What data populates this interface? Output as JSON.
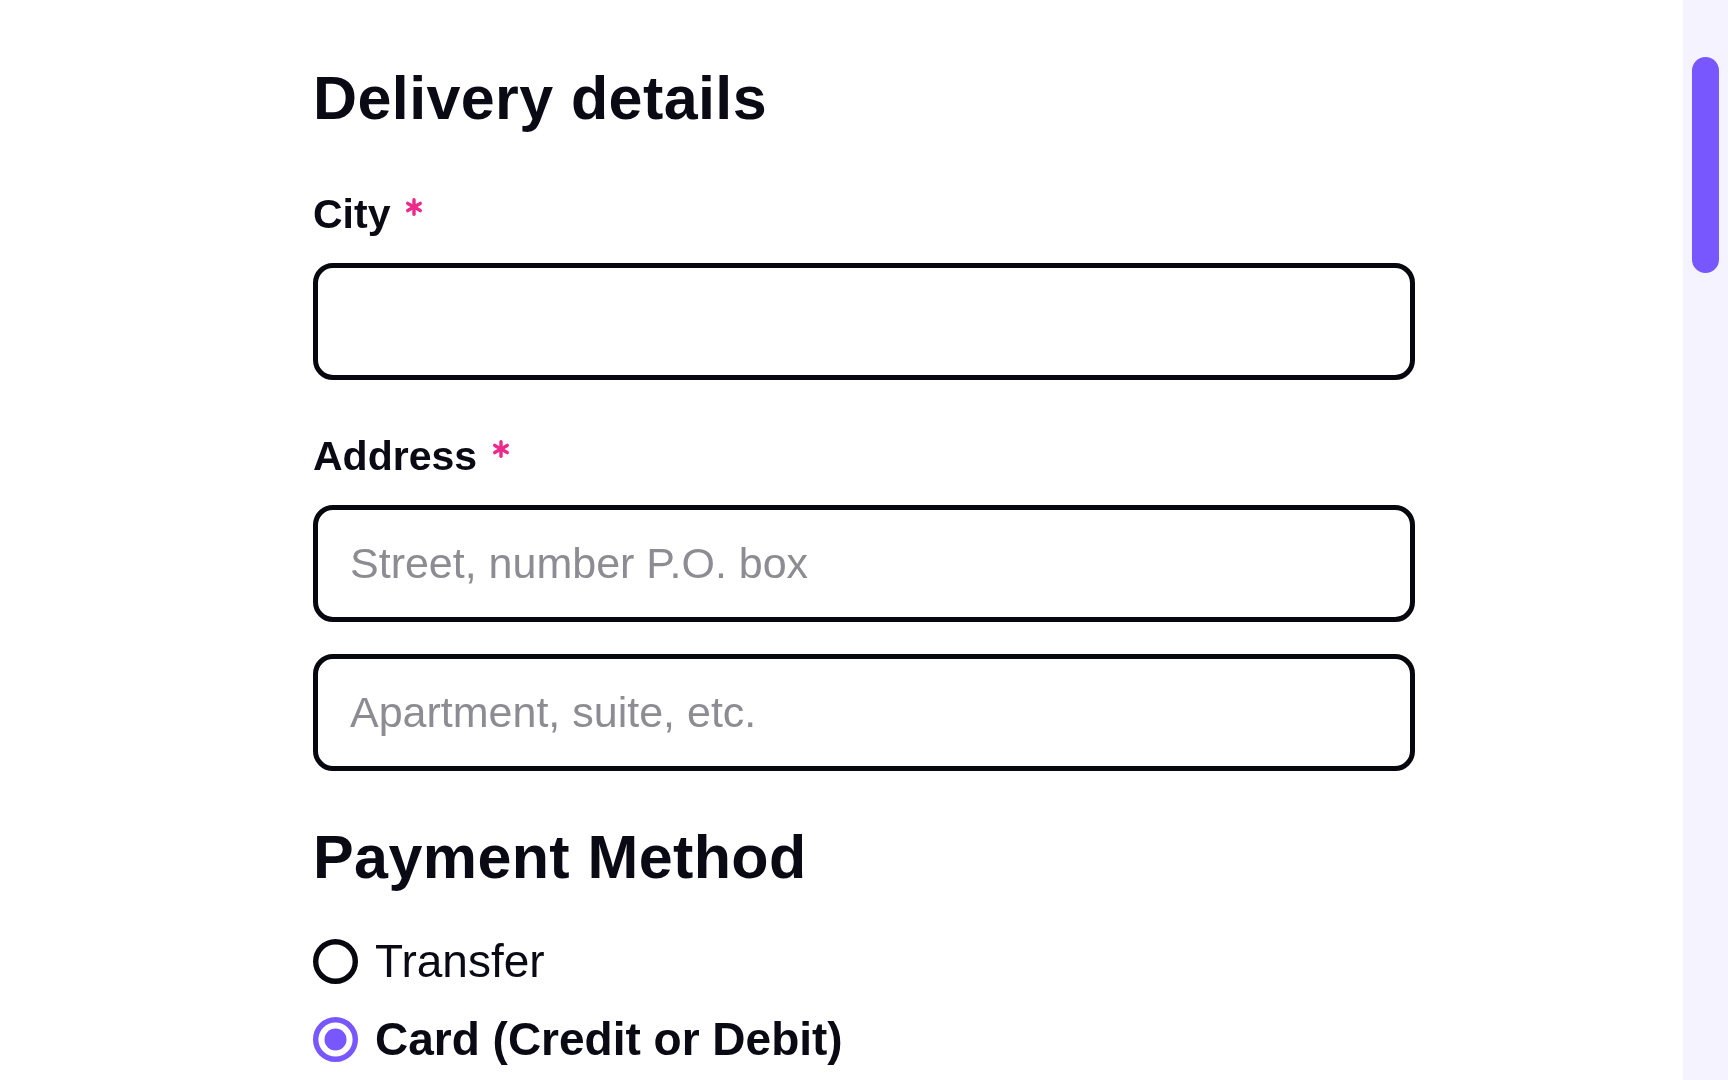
{
  "delivery": {
    "title": "Delivery details",
    "fields": [
      {
        "label": "City",
        "required": true,
        "inputs": [
          {
            "kind": "text"
          }
        ]
      },
      {
        "label": "Address",
        "required": true,
        "inputs": [
          {
            "kind": "text",
            "placeholder": "Street, number P.O. box"
          },
          {
            "kind": "text",
            "placeholder": "Apartment, suite, etc."
          }
        ]
      }
    ]
  },
  "payment": {
    "title": "Payment Method",
    "options": [
      {
        "label": "Transfer",
        "selected": false
      },
      {
        "label": "Card (Credit or Debit)",
        "selected": true
      }
    ]
  }
}
